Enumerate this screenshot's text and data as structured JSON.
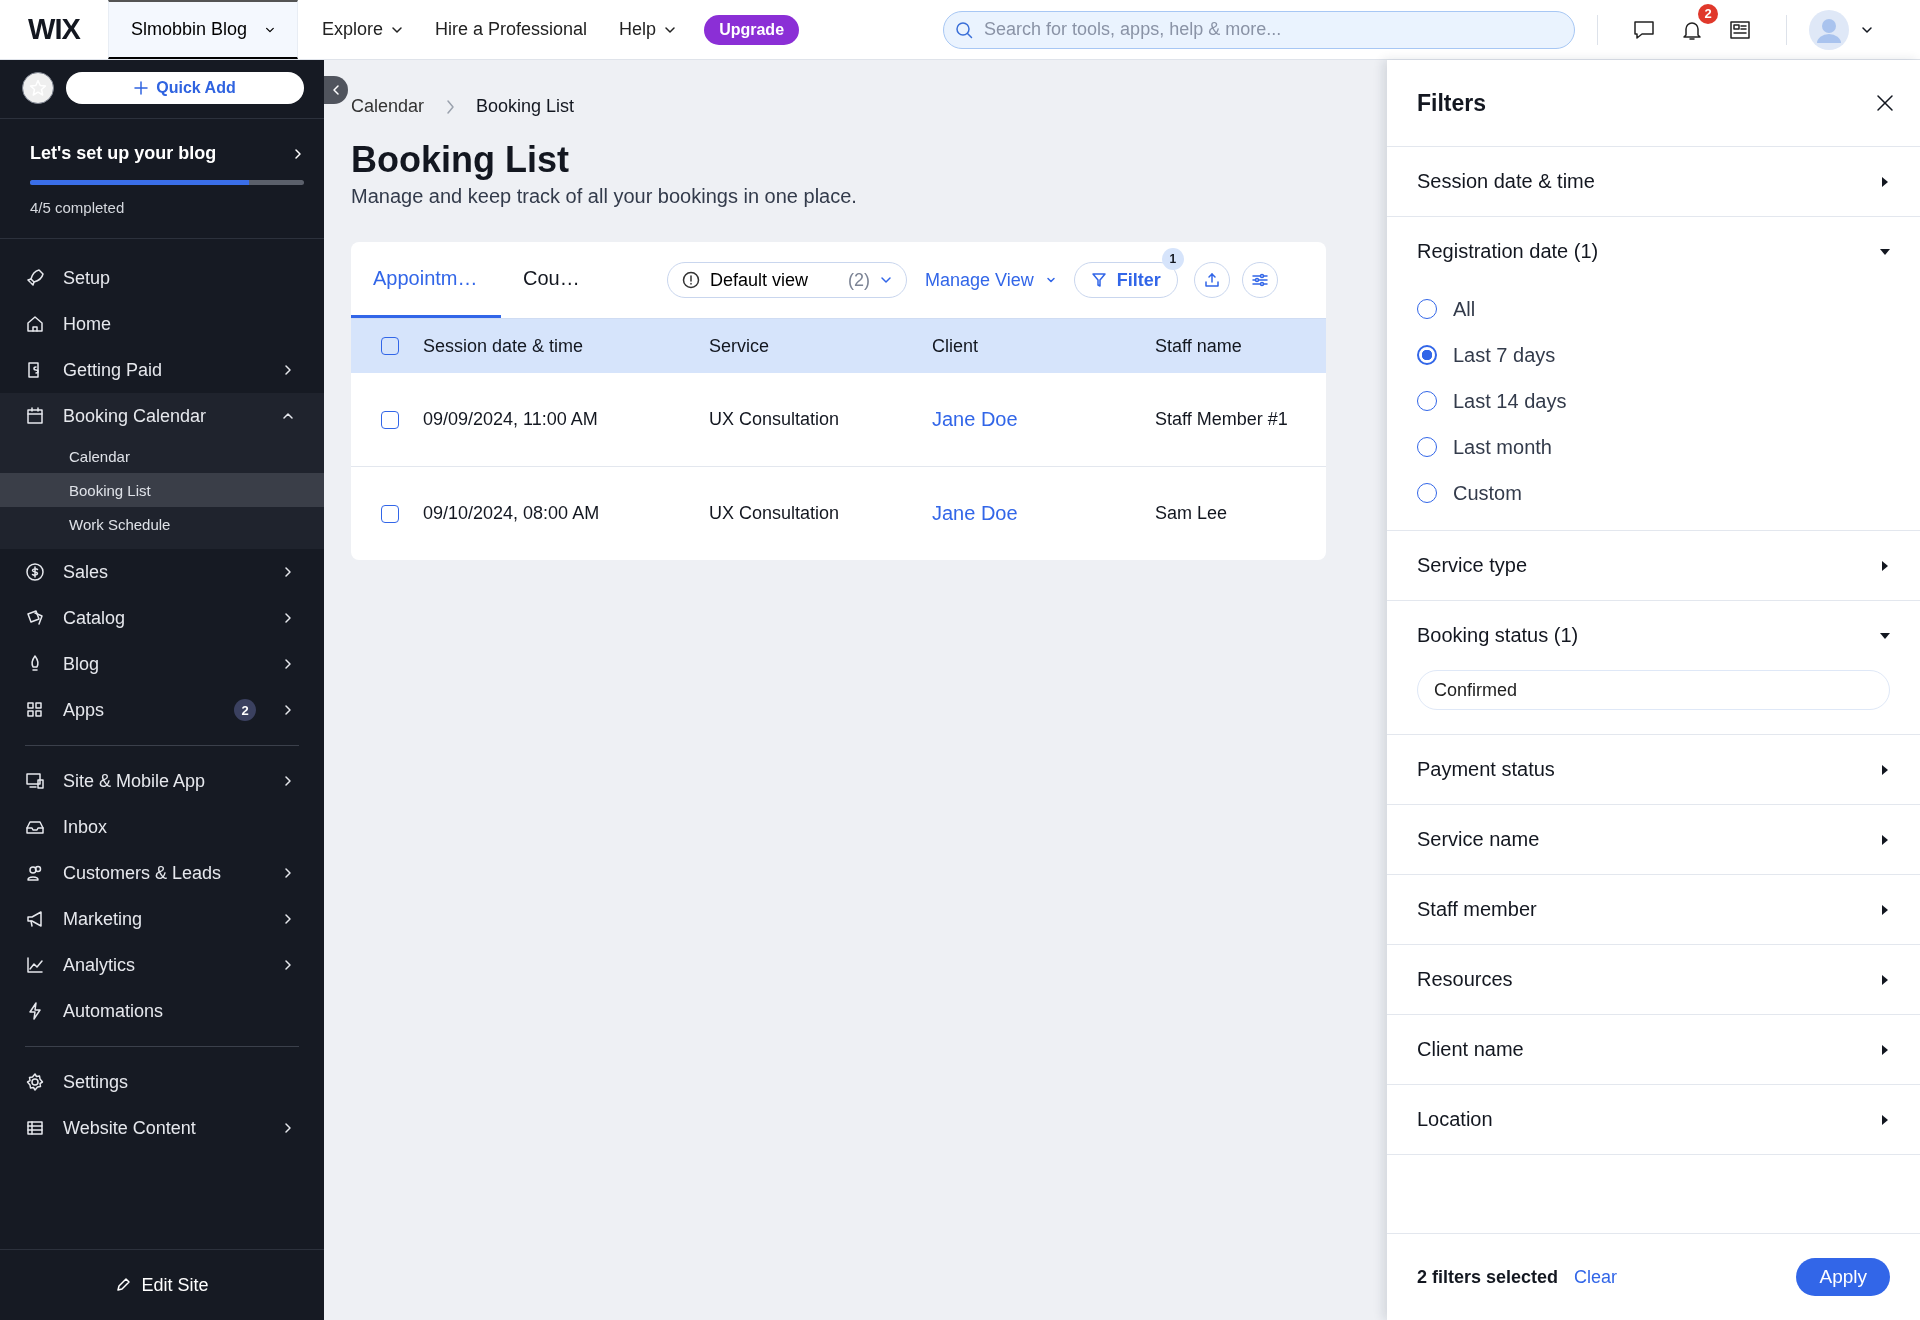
{
  "topbar": {
    "logo": "WIX",
    "site": "Slmobbin Blog",
    "nav": [
      {
        "label": "Explore",
        "dropdown": true
      },
      {
        "label": "Hire a Professional",
        "dropdown": false
      },
      {
        "label": "Help",
        "dropdown": true
      }
    ],
    "upgrade": "Upgrade",
    "search": {
      "placeholder": "Search for tools, apps, help & more..."
    },
    "notification_count": "2"
  },
  "sidebar": {
    "quick_add": "Quick Add",
    "setup": {
      "title": "Let's set up your blog",
      "level": 0.8,
      "progress_text": "4/5 completed"
    },
    "groups": [
      [
        {
          "label": "Setup",
          "arrow": false
        },
        {
          "label": "Home",
          "arrow": false
        },
        {
          "label": "Getting Paid",
          "arrow": true
        },
        {
          "label": "Booking Calendar",
          "arrow": true,
          "expanded": true,
          "children": [
            {
              "label": "Calendar",
              "selected": false
            },
            {
              "label": "Booking List",
              "selected": true
            },
            {
              "label": "Work Schedule",
              "selected": false
            }
          ]
        },
        {
          "label": "Sales",
          "arrow": true
        },
        {
          "label": "Catalog",
          "arrow": true
        },
        {
          "label": "Blog",
          "arrow": true
        },
        {
          "label": "Apps",
          "arrow": true,
          "badge": "2"
        }
      ],
      [
        {
          "label": "Site & Mobile App",
          "arrow": true
        },
        {
          "label": "Inbox",
          "arrow": false
        },
        {
          "label": "Customers & Leads",
          "arrow": true
        },
        {
          "label": "Marketing",
          "arrow": true
        },
        {
          "label": "Analytics",
          "arrow": true
        },
        {
          "label": "Automations",
          "arrow": false
        }
      ],
      [
        {
          "label": "Settings",
          "arrow": false
        },
        {
          "label": "Website Content",
          "arrow": true
        }
      ]
    ],
    "edit_site": "Edit Site"
  },
  "main": {
    "breadcrumbs": [
      "Calendar",
      "Booking List"
    ],
    "title": "Booking List",
    "subtitle": "Manage and keep track of all your bookings in one place.",
    "tabs": [
      {
        "label": "Appointm…",
        "selected": true
      },
      {
        "label": "Cou…",
        "selected": false
      }
    ],
    "view": {
      "label": "Default view",
      "count": "(2)"
    },
    "manage_view": "Manage View",
    "filter": {
      "label": "Filter",
      "badge": "1"
    },
    "table": {
      "select_all_checked": false,
      "columns": [
        "Session date & time",
        "Service",
        "Client",
        "Staff name"
      ],
      "rows": [
        {
          "checked": false,
          "cells": [
            "09/09/2024, 11:00 AM",
            "UX Consultation",
            "Jane Doe",
            "Staff Member #1"
          ]
        },
        {
          "checked": false,
          "cells": [
            "09/10/2024, 08:00 AM",
            "UX Consultation",
            "Jane Doe",
            "Sam Lee"
          ]
        }
      ]
    }
  },
  "filters": {
    "title": "Filters",
    "sections": [
      {
        "label": "Session date & time",
        "expanded": false
      },
      {
        "label": "Registration date (1)",
        "expanded": true,
        "options": [
          {
            "label": "All",
            "selected": false
          },
          {
            "label": "Last 7 days",
            "selected": true
          },
          {
            "label": "Last 14 days",
            "selected": false
          },
          {
            "label": "Last month",
            "selected": false
          },
          {
            "label": "Custom",
            "selected": false
          }
        ]
      },
      {
        "label": "Service type",
        "expanded": false
      },
      {
        "label": "Booking status (1)",
        "expanded": true,
        "chips": [
          "Confirmed"
        ]
      },
      {
        "label": "Payment status",
        "expanded": false
      },
      {
        "label": "Service name",
        "expanded": false
      },
      {
        "label": "Staff member",
        "expanded": false
      },
      {
        "label": "Resources",
        "expanded": false
      },
      {
        "label": "Client name",
        "expanded": false
      },
      {
        "label": "Location",
        "expanded": false
      }
    ],
    "summary": "2 filters selected",
    "clear": "Clear",
    "apply": "Apply"
  }
}
